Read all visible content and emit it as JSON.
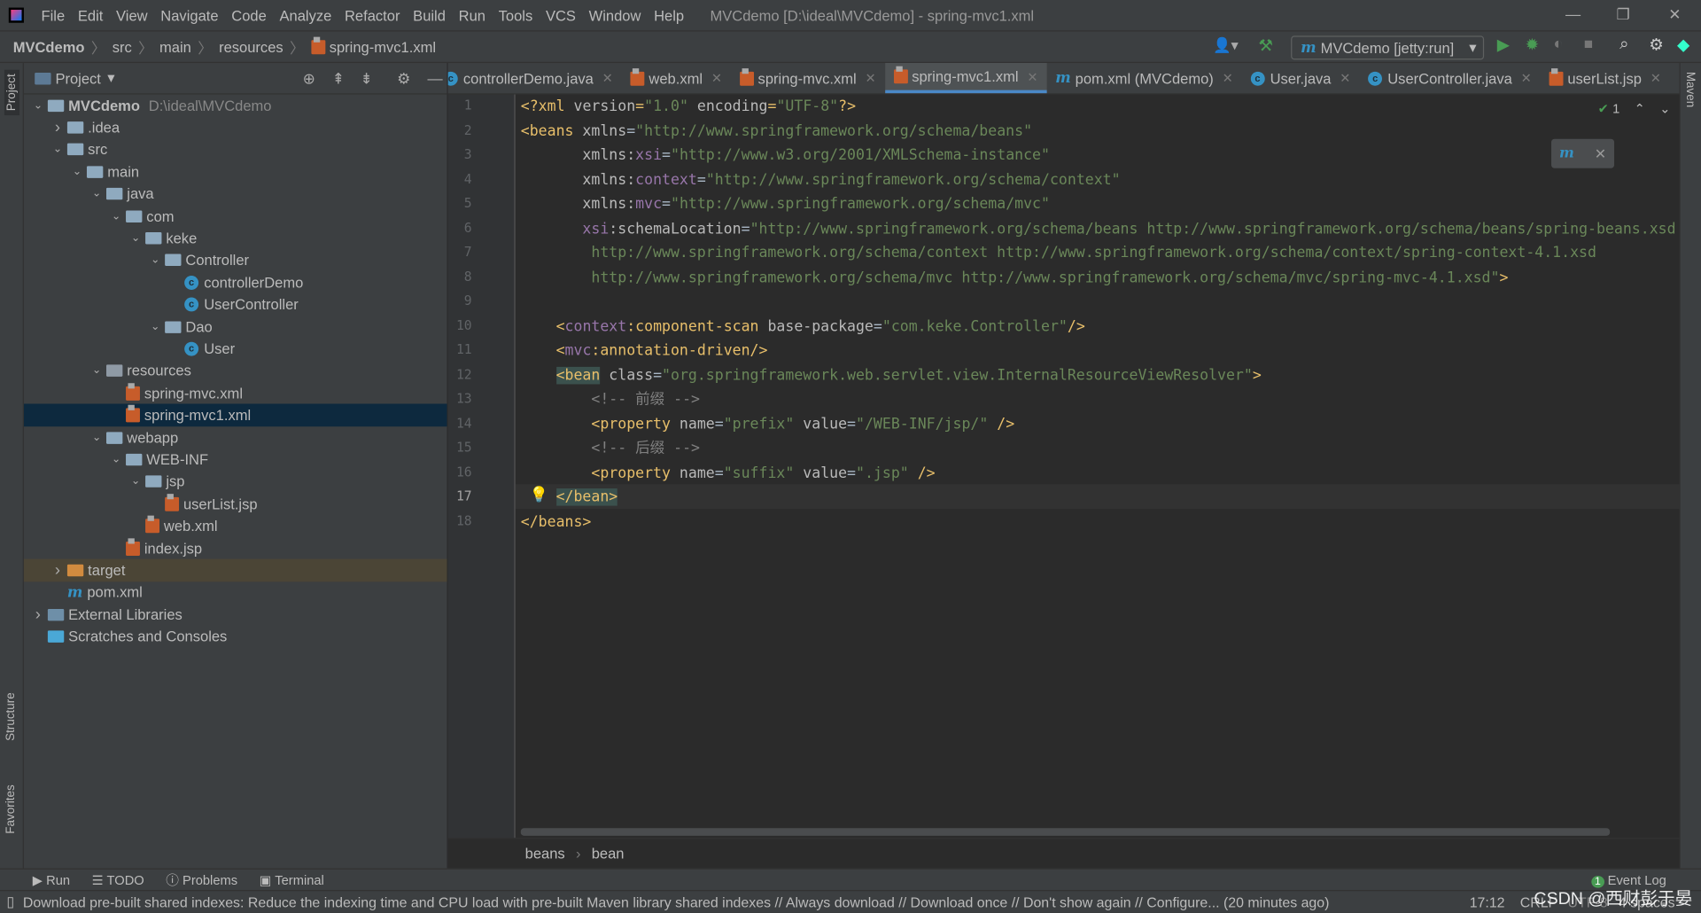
{
  "window": {
    "title": "MVCdemo [D:\\ideal\\MVCdemo] - spring-mvc1.xml"
  },
  "menu": [
    "File",
    "Edit",
    "View",
    "Navigate",
    "Code",
    "Analyze",
    "Refactor",
    "Build",
    "Run",
    "Tools",
    "VCS",
    "Window",
    "Help"
  ],
  "breadcrumb": [
    "MVCdemo",
    "src",
    "main",
    "resources",
    "spring-mvc1.xml"
  ],
  "run_config": "MVCdemo [jetty:run]",
  "project_panel": {
    "title": "Project",
    "tree": [
      {
        "label": "MVCdemo",
        "path": "D:\\ideal\\MVCdemo",
        "depth": 0,
        "arrow": "v",
        "icon": "module-folder",
        "bold": true
      },
      {
        "label": ".idea",
        "depth": 1,
        "arrow": ">",
        "icon": "folder"
      },
      {
        "label": "src",
        "depth": 1,
        "arrow": "v",
        "icon": "folder"
      },
      {
        "label": "main",
        "depth": 2,
        "arrow": "v",
        "icon": "folder"
      },
      {
        "label": "java",
        "depth": 3,
        "arrow": "v",
        "icon": "source-folder"
      },
      {
        "label": "com",
        "depth": 4,
        "arrow": "v",
        "icon": "package"
      },
      {
        "label": "keke",
        "depth": 5,
        "arrow": "v",
        "icon": "package"
      },
      {
        "label": "Controller",
        "depth": 6,
        "arrow": "v",
        "icon": "package"
      },
      {
        "label": "controllerDemo",
        "depth": 7,
        "arrow": "",
        "icon": "class"
      },
      {
        "label": "UserController",
        "depth": 7,
        "arrow": "",
        "icon": "class"
      },
      {
        "label": "Dao",
        "depth": 6,
        "arrow": "v",
        "icon": "package"
      },
      {
        "label": "User",
        "depth": 7,
        "arrow": "",
        "icon": "class"
      },
      {
        "label": "resources",
        "depth": 3,
        "arrow": "v",
        "icon": "resources"
      },
      {
        "label": "spring-mvc.xml",
        "depth": 4,
        "arrow": "",
        "icon": "xml"
      },
      {
        "label": "spring-mvc1.xml",
        "depth": 4,
        "arrow": "",
        "icon": "xml",
        "selected": true
      },
      {
        "label": "webapp",
        "depth": 3,
        "arrow": "v",
        "icon": "folder"
      },
      {
        "label": "WEB-INF",
        "depth": 4,
        "arrow": "v",
        "icon": "folder"
      },
      {
        "label": "jsp",
        "depth": 5,
        "arrow": "v",
        "icon": "folder"
      },
      {
        "label": "userList.jsp",
        "depth": 6,
        "arrow": "",
        "icon": "jsp"
      },
      {
        "label": "web.xml",
        "depth": 5,
        "arrow": "",
        "icon": "xml"
      },
      {
        "label": "index.jsp",
        "depth": 4,
        "arrow": "",
        "icon": "jsp"
      },
      {
        "label": "target",
        "depth": 1,
        "arrow": ">",
        "icon": "target",
        "excluded": true
      },
      {
        "label": "pom.xml",
        "depth": 1,
        "arrow": "",
        "icon": "maven"
      },
      {
        "label": "External Libraries",
        "depth": 0,
        "arrow": ">",
        "icon": "libraries"
      },
      {
        "label": "Scratches and Consoles",
        "depth": 0,
        "arrow": "",
        "icon": "scratches"
      }
    ]
  },
  "tabs": [
    {
      "label": "controllerDemo.java",
      "icon": "class"
    },
    {
      "label": "web.xml",
      "icon": "xml"
    },
    {
      "label": "spring-mvc.xml",
      "icon": "xml"
    },
    {
      "label": "spring-mvc1.xml",
      "icon": "xml",
      "active": true
    },
    {
      "label": "pom.xml (MVCdemo)",
      "icon": "maven"
    },
    {
      "label": "User.java",
      "icon": "class"
    },
    {
      "label": "UserController.java",
      "icon": "class"
    },
    {
      "label": "userList.jsp",
      "icon": "jsp"
    }
  ],
  "editor": {
    "current_line": 17,
    "inspection_count": "1",
    "lines": [
      [
        [
          "tg",
          "<?xml "
        ],
        [
          "at",
          "version"
        ],
        [
          "tg",
          "="
        ],
        [
          "vl",
          "\"1.0\""
        ],
        [
          "tg",
          " "
        ],
        [
          "at",
          "encoding"
        ],
        [
          "tg",
          "="
        ],
        [
          "vl",
          "\"UTF-8\""
        ],
        [
          "tg",
          "?>"
        ]
      ],
      [
        [
          "tg",
          "<beans "
        ],
        [
          "at",
          "xmlns"
        ],
        [
          "tx",
          "="
        ],
        [
          "vl",
          "\"http://www.springframework.org/schema/beans\""
        ]
      ],
      [
        [
          "tx",
          "       "
        ],
        [
          "at",
          "xmlns:"
        ],
        [
          "ns",
          "xsi"
        ],
        [
          "tx",
          "="
        ],
        [
          "vl",
          "\"http://www.w3.org/2001/XMLSchema-instance\""
        ]
      ],
      [
        [
          "tx",
          "       "
        ],
        [
          "at",
          "xmlns:"
        ],
        [
          "ns",
          "context"
        ],
        [
          "tx",
          "="
        ],
        [
          "vl",
          "\"http://www.springframework.org/schema/context\""
        ]
      ],
      [
        [
          "tx",
          "       "
        ],
        [
          "at",
          "xmlns:"
        ],
        [
          "ns",
          "mvc"
        ],
        [
          "tx",
          "="
        ],
        [
          "vl",
          "\"http://www.springframework.org/schema/mvc\""
        ]
      ],
      [
        [
          "tx",
          "       "
        ],
        [
          "ns",
          "xsi"
        ],
        [
          "at",
          ":schemaLocation"
        ],
        [
          "tx",
          "="
        ],
        [
          "vl",
          "\"http://www.springframework.org/schema/beans http://www.springframework.org/schema/beans/spring-beans.xsd"
        ]
      ],
      [
        [
          "vl",
          "        http://www.springframework.org/schema/context http://www.springframework.org/schema/context/spring-context-4.1.xsd"
        ]
      ],
      [
        [
          "vl",
          "        http://www.springframework.org/schema/mvc http://www.springframework.org/schema/mvc/spring-mvc-4.1.xsd\""
        ],
        [
          "tg",
          ">"
        ]
      ],
      [],
      [
        [
          "tx",
          "    "
        ],
        [
          "tg",
          "<"
        ],
        [
          "ns",
          "context"
        ],
        [
          "tg",
          ":component-scan "
        ],
        [
          "at",
          "base-package"
        ],
        [
          "tx",
          "="
        ],
        [
          "vl",
          "\"com.keke.Controller\""
        ],
        [
          "tg",
          "/>"
        ]
      ],
      [
        [
          "tx",
          "    "
        ],
        [
          "tg",
          "<"
        ],
        [
          "ns",
          "mvc"
        ],
        [
          "tg",
          ":annotation-driven/>"
        ]
      ],
      [
        [
          "tx",
          "    "
        ],
        [
          "tg hl",
          "<bean"
        ],
        [
          "tg",
          " "
        ],
        [
          "at",
          "class"
        ],
        [
          "tx",
          "="
        ],
        [
          "vl",
          "\"org.springframework.web.servlet.view.InternalResourceViewResolver\""
        ],
        [
          "tg",
          ">"
        ]
      ],
      [
        [
          "cm",
          "        <!-- 前缀 -->"
        ]
      ],
      [
        [
          "tx",
          "        "
        ],
        [
          "tg",
          "<property "
        ],
        [
          "at",
          "name"
        ],
        [
          "tx",
          "="
        ],
        [
          "vl",
          "\"prefix\""
        ],
        [
          "tx",
          " "
        ],
        [
          "at",
          "value"
        ],
        [
          "tx",
          "="
        ],
        [
          "vl",
          "\"/WEB-INF/jsp/\""
        ],
        [
          "tg",
          " />"
        ]
      ],
      [
        [
          "cm",
          "        <!-- 后缀 -->"
        ]
      ],
      [
        [
          "tx",
          "        "
        ],
        [
          "tg",
          "<property "
        ],
        [
          "at",
          "name"
        ],
        [
          "tx",
          "="
        ],
        [
          "vl",
          "\"suffix\""
        ],
        [
          "tx",
          " "
        ],
        [
          "at",
          "value"
        ],
        [
          "tx",
          "="
        ],
        [
          "vl",
          "\".jsp\""
        ],
        [
          "tg",
          " />"
        ]
      ],
      [
        [
          "tx",
          "    "
        ],
        [
          "tg hl",
          "</bean>"
        ]
      ],
      [
        [
          "tg",
          "</beans>"
        ]
      ]
    ]
  },
  "editor_breadcrumb": [
    "beans",
    "bean"
  ],
  "tool_windows": {
    "run": "Run",
    "todo": "TODO",
    "problems": "Problems",
    "terminal": "Terminal",
    "event_log": "Event Log",
    "event_count": "1",
    "project": "Project",
    "structure": "Structure",
    "favorites": "Favorites",
    "maven": "Maven"
  },
  "status": {
    "message": "Download pre-built shared indexes: Reduce the indexing time and CPU load with pre-built Maven library shared indexes // Always download // Download once // Don't show again // Configure... (20 minutes ago)",
    "position": "17:12",
    "line_sep": "CRLF",
    "encoding": "UTF-8",
    "indent": "4 spaces"
  },
  "watermark": "CSDN @西财彭于晏",
  "colors": {
    "accent": "#4a88c7",
    "selection": "#0d293e",
    "tag": "#e8bf6a",
    "value": "#6a8759"
  }
}
